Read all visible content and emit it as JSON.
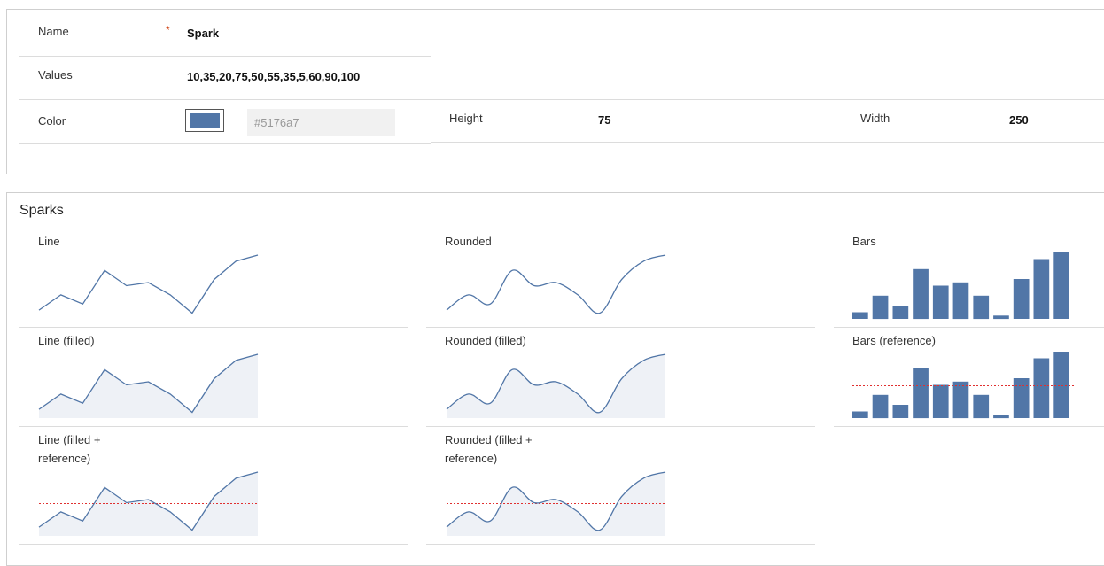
{
  "form": {
    "name_label": "Name",
    "required_mark": "*",
    "name_value": "Spark",
    "values_label": "Values",
    "values_value": "10,35,20,75,50,55,35,5,60,90,100",
    "color_label": "Color",
    "color_hex": "#5176a7",
    "height_label": "Height",
    "height_value": "75",
    "width_label": "Width",
    "width_value": "250"
  },
  "sparks": {
    "section_title": "Sparks",
    "titles": {
      "line": "Line",
      "rounded": "Rounded",
      "bars": "Bars",
      "line_filled": "Line (filled)",
      "rounded_filled": "Rounded (filled)",
      "bars_reference": "Bars (reference)",
      "line_filled_reference": "Line (filled + reference)",
      "rounded_filled_reference": "Rounded (filled + reference)"
    }
  },
  "colors": {
    "accent": "#5176a7",
    "fill": "#eef1f6",
    "reference": "#e03030"
  },
  "chart_data": {
    "type": "line",
    "values": [
      10,
      35,
      20,
      75,
      50,
      55,
      35,
      5,
      60,
      90,
      100
    ],
    "ylim": [
      0,
      100
    ]
  }
}
